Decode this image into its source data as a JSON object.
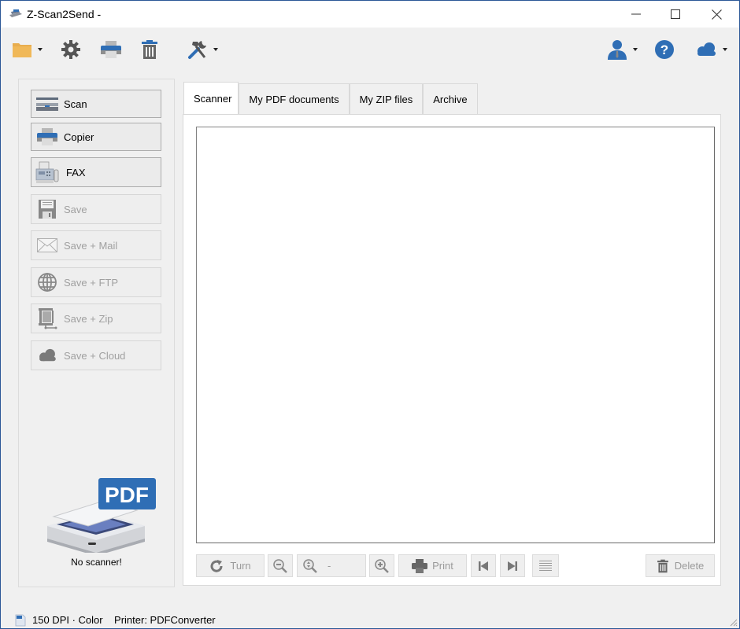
{
  "window": {
    "title": "Z-Scan2Send -",
    "controls": {
      "minimize": "minimize",
      "maximize": "maximize",
      "close": "close"
    }
  },
  "toolbar": {
    "left": [
      {
        "icon": "folder-icon",
        "dropdown": true
      },
      {
        "icon": "gear-icon",
        "dropdown": false
      },
      {
        "icon": "printer-icon",
        "dropdown": false
      },
      {
        "icon": "trash-icon",
        "dropdown": false
      },
      {
        "icon": "tools-icon",
        "dropdown": true
      }
    ],
    "right": [
      {
        "icon": "user-icon",
        "dropdown": true
      },
      {
        "icon": "help-icon",
        "dropdown": false
      },
      {
        "icon": "cloud-icon",
        "dropdown": true
      }
    ]
  },
  "sidebar": {
    "buttons": [
      {
        "label": "Scan",
        "icon": "scanner-icon",
        "enabled": true
      },
      {
        "label": "Copier",
        "icon": "copier-icon",
        "enabled": true
      },
      {
        "label": "FAX",
        "icon": "fax-icon",
        "enabled": true
      },
      {
        "label": "Save",
        "icon": "floppy-icon",
        "enabled": false
      },
      {
        "label": "Save + Mail",
        "icon": "envelope-icon",
        "enabled": false
      },
      {
        "label": "Save + FTP",
        "icon": "globe-icon",
        "enabled": false
      },
      {
        "label": "Save + Zip",
        "icon": "zip-icon",
        "enabled": false
      },
      {
        "label": "Save + Cloud",
        "icon": "cloud-icon",
        "enabled": false
      }
    ],
    "pdf_badge": "PDF",
    "scanner_status": "No scanner!"
  },
  "tabs": [
    {
      "label": "Scanner",
      "active": true
    },
    {
      "label": "My PDF documents",
      "active": false
    },
    {
      "label": "My ZIP files",
      "active": false
    },
    {
      "label": "Archive",
      "active": false
    }
  ],
  "preview_toolbar": {
    "turn_label": "Turn",
    "zoom_value": "-",
    "print_label": "Print",
    "delete_label": "Delete"
  },
  "colors": {
    "accent_blue": "#2f6eb5",
    "window_border": "#2b5797",
    "folder": "#e8ad4f",
    "disabled_text": "#a0a0a0"
  },
  "status": {
    "scan_settings": "150 DPI · Color",
    "printer": "Printer: PDFConverter"
  }
}
